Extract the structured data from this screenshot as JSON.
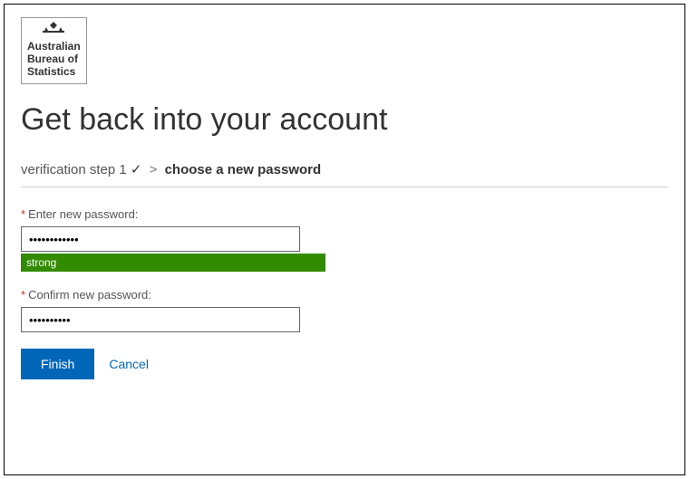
{
  "logo": {
    "line1": "Australian",
    "line2": "Bureau of",
    "line3": "Statistics"
  },
  "heading": "Get back into your account",
  "breadcrumb": {
    "step1": "verification step 1",
    "checkmark": "✓",
    "separator": ">",
    "current": "choose a new password"
  },
  "fields": {
    "new_password": {
      "label": "Enter new password:",
      "value": "••••••••••••",
      "strength": "strong"
    },
    "confirm_password": {
      "label": "Confirm new password:",
      "value": "••••••••••"
    }
  },
  "actions": {
    "finish": "Finish",
    "cancel": "Cancel"
  },
  "required_marker": "*"
}
